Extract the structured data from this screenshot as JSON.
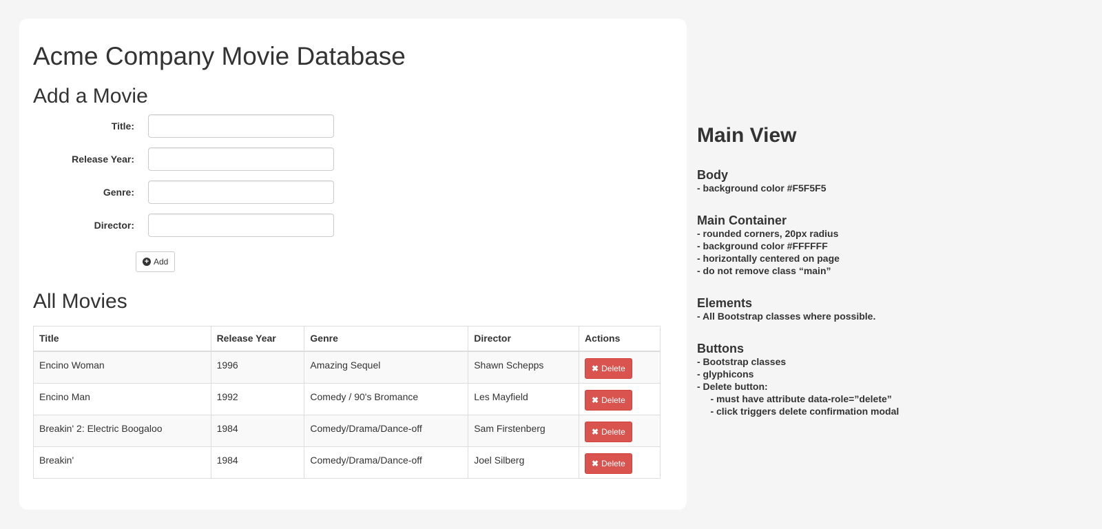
{
  "page": {
    "title": "Acme Company Movie Database"
  },
  "add_form": {
    "heading": "Add a Movie",
    "fields": [
      {
        "label": "Title:",
        "value": ""
      },
      {
        "label": "Release Year:",
        "value": ""
      },
      {
        "label": "Genre:",
        "value": ""
      },
      {
        "label": "Director:",
        "value": ""
      }
    ],
    "add_label": "Add"
  },
  "movies": {
    "heading": "All Movies",
    "columns": [
      "Title",
      "Release Year",
      "Genre",
      "Director",
      "Actions"
    ],
    "rows": [
      {
        "title": "Encino Woman",
        "year": "1996",
        "genre": "Amazing Sequel",
        "director": "Shawn Schepps",
        "action": "Delete"
      },
      {
        "title": "Encino Man",
        "year": "1992",
        "genre": "Comedy / 90's Bromance",
        "director": "Les Mayfield",
        "action": "Delete"
      },
      {
        "title": "Breakin' 2: Electric Boogaloo",
        "year": "1984",
        "genre": "Comedy/Drama/Dance-off",
        "director": "Sam Firstenberg",
        "action": "Delete"
      },
      {
        "title": "Breakin'",
        "year": "1984",
        "genre": "Comedy/Drama/Dance-off",
        "director": "Joel Silberg",
        "action": "Delete"
      }
    ]
  },
  "notes": {
    "title": "Main View",
    "groups": [
      {
        "head": "Body",
        "lines": [
          "- background color #F5F5F5"
        ]
      },
      {
        "head": "Main Container",
        "lines": [
          "- rounded corners, 20px radius",
          "- background color #FFFFFF",
          "- horizontally centered on page",
          "- do not remove class “main”"
        ]
      },
      {
        "head": "Elements",
        "lines": [
          "- All Bootstrap classes where possible."
        ]
      },
      {
        "head": "Buttons",
        "lines": [
          "- Bootstrap classes",
          "- glyphicons",
          "- Delete button:",
          "     - must have attribute data-role=”delete”",
          "     - click triggers delete confirmation modal"
        ]
      }
    ]
  },
  "colors": {
    "body_bg": "#F5F5F5",
    "container_bg": "#FFFFFF",
    "delete_btn": "#d9534f"
  },
  "icons": {
    "add": "plus-sign-circle",
    "delete": "remove-x"
  }
}
